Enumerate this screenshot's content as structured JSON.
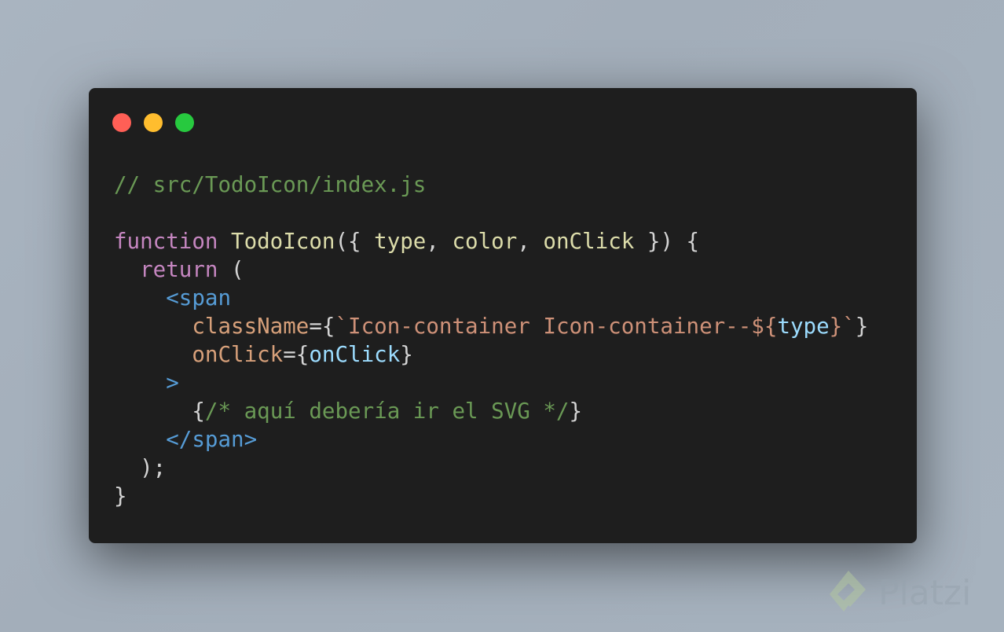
{
  "window": {
    "controls": [
      {
        "name": "close",
        "color": "#ff5f56"
      },
      {
        "name": "minimize",
        "color": "#ffbd2e"
      },
      {
        "name": "maximize",
        "color": "#27c93f"
      }
    ]
  },
  "code": {
    "lines": [
      [
        [
          "// src/TodoIcon/index.js",
          "comment"
        ]
      ],
      [],
      [
        [
          "function",
          "keyword"
        ],
        [
          " ",
          "punct"
        ],
        [
          "TodoIcon",
          "func"
        ],
        [
          "({ ",
          "punct"
        ],
        [
          "type",
          "param"
        ],
        [
          ", ",
          "punct"
        ],
        [
          "color",
          "param"
        ],
        [
          ", ",
          "punct"
        ],
        [
          "onClick",
          "param"
        ],
        [
          " }) {",
          "punct"
        ]
      ],
      [
        [
          "  ",
          "punct"
        ],
        [
          "return",
          "keyword"
        ],
        [
          " (",
          "punct"
        ]
      ],
      [
        [
          "    ",
          "punct"
        ],
        [
          "<span",
          "tag"
        ]
      ],
      [
        [
          "      ",
          "punct"
        ],
        [
          "className",
          "attr"
        ],
        [
          "={",
          "punct"
        ],
        [
          "`Icon-container Icon-container--",
          "string"
        ],
        [
          "${",
          "string"
        ],
        [
          "type",
          "var"
        ],
        [
          "}",
          "string"
        ],
        [
          "`",
          "string"
        ],
        [
          "}",
          "punct"
        ]
      ],
      [
        [
          "      ",
          "punct"
        ],
        [
          "onClick",
          "attr"
        ],
        [
          "={",
          "punct"
        ],
        [
          "onClick",
          "var"
        ],
        [
          "}",
          "punct"
        ]
      ],
      [
        [
          "    ",
          "punct"
        ],
        [
          ">",
          "tag"
        ]
      ],
      [
        [
          "      ",
          "punct"
        ],
        [
          "{",
          "punct"
        ],
        [
          "/* aquí debería ir el SVG */",
          "comment"
        ],
        [
          "}",
          "punct"
        ]
      ],
      [
        [
          "    ",
          "punct"
        ],
        [
          "</span>",
          "tag"
        ]
      ],
      [
        [
          "  );",
          "punct"
        ]
      ],
      [
        [
          "}",
          "punct"
        ]
      ]
    ]
  },
  "watermark": {
    "text": "Platzi"
  }
}
